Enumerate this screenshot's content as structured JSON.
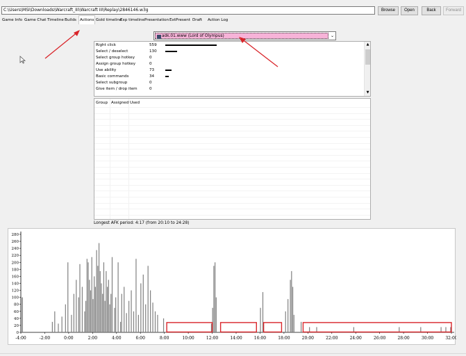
{
  "path_value": "C:\\Users\\MSI\\Downloads\\Warcraft_III\\Warcraft III\\Replay\\2846146.w3g",
  "buttons": {
    "browse": "Browse",
    "open": "Open",
    "back": "Back",
    "forward": "Forward"
  },
  "tabs": [
    "Game Info",
    "Game Chat",
    "Timeline",
    "Builds",
    "Actions",
    "Gold timeline",
    "Exp timeline",
    "Presentation",
    "ExtPresent",
    "Draft",
    "Action Log"
  ],
  "active_tab": "Actions",
  "player_select": {
    "value": "adk.01.www (Lord of Olympus)"
  },
  "actions": [
    {
      "label": "Right click",
      "value": "559",
      "count": 559
    },
    {
      "label": "Select / deselect",
      "value": "130",
      "count": 130
    },
    {
      "label": "Select group hotkey",
      "value": "0",
      "count": 0
    },
    {
      "label": "Assign group hotkey",
      "value": "0",
      "count": 0
    },
    {
      "label": "Use ability",
      "value": "73",
      "count": 73
    },
    {
      "label": "Basic commands",
      "value": "34",
      "count": 34
    },
    {
      "label": "Select subgroup",
      "value": "0",
      "count": 0
    },
    {
      "label": "Give item / drop item",
      "value": "0",
      "count": 0
    }
  ],
  "groups_table": {
    "columns": [
      "Group",
      "Assigned",
      "Used"
    ]
  },
  "afk_text": "Longest AFK period: 4:17 (from 20:10 to 24:28)",
  "colors": {
    "player_highlight": "#f7b3d8",
    "bar": "#808080",
    "annotation": "#d9252a"
  },
  "chart_data": {
    "type": "bar",
    "x_ticks": [
      "-4:00",
      "-2:00",
      "0:00",
      "2:00",
      "4:00",
      "6:00",
      "8:00",
      "10:00",
      "12:00",
      "14:00",
      "16:00",
      "18:00",
      "20:00",
      "22:00",
      "24:00",
      "26:00",
      "28:00",
      "30:00",
      "32:00"
    ],
    "y_ticks": [
      0,
      20,
      40,
      60,
      80,
      100,
      120,
      140,
      160,
      180,
      200,
      220,
      240,
      260,
      280
    ],
    "xlim_minutes": [
      -4,
      32
    ],
    "ylim": [
      0,
      280
    ],
    "grid": false,
    "bars": [
      [
        -4.0,
        100
      ],
      [
        -3.9,
        100
      ],
      [
        -1.4,
        30
      ],
      [
        -1.2,
        60
      ],
      [
        -0.9,
        25
      ],
      [
        -0.6,
        45
      ],
      [
        -0.3,
        80
      ],
      [
        -0.1,
        200
      ],
      [
        0.2,
        50
      ],
      [
        0.4,
        110
      ],
      [
        0.6,
        150
      ],
      [
        0.8,
        100
      ],
      [
        0.9,
        195
      ],
      [
        1.1,
        130
      ],
      [
        1.3,
        60
      ],
      [
        1.4,
        90
      ],
      [
        1.5,
        210
      ],
      [
        1.6,
        200
      ],
      [
        1.7,
        150
      ],
      [
        1.8,
        120
      ],
      [
        1.9,
        215
      ],
      [
        2.0,
        95
      ],
      [
        2.1,
        160
      ],
      [
        2.2,
        130
      ],
      [
        2.3,
        235
      ],
      [
        2.4,
        190
      ],
      [
        2.5,
        255
      ],
      [
        2.6,
        175
      ],
      [
        2.7,
        140
      ],
      [
        2.8,
        110
      ],
      [
        2.9,
        200
      ],
      [
        3.0,
        90
      ],
      [
        3.1,
        175
      ],
      [
        3.2,
        130
      ],
      [
        3.3,
        150
      ],
      [
        3.4,
        80
      ],
      [
        3.5,
        110
      ],
      [
        3.6,
        215
      ],
      [
        3.8,
        70
      ],
      [
        3.9,
        100
      ],
      [
        4.1,
        200
      ],
      [
        4.3,
        30
      ],
      [
        4.4,
        110
      ],
      [
        4.6,
        130
      ],
      [
        4.8,
        55
      ],
      [
        5.0,
        90
      ],
      [
        5.2,
        120
      ],
      [
        5.4,
        60
      ],
      [
        5.6,
        210
      ],
      [
        5.8,
        50
      ],
      [
        6.0,
        140
      ],
      [
        6.2,
        165
      ],
      [
        6.4,
        80
      ],
      [
        6.6,
        190
      ],
      [
        6.8,
        120
      ],
      [
        7.0,
        85
      ],
      [
        7.2,
        60
      ],
      [
        7.4,
        50
      ],
      [
        7.9,
        40
      ],
      [
        11.9,
        25
      ],
      [
        12.0,
        70
      ],
      [
        12.1,
        190
      ],
      [
        12.2,
        200
      ],
      [
        12.3,
        100
      ],
      [
        16.0,
        70
      ],
      [
        16.2,
        115
      ],
      [
        18.1,
        60
      ],
      [
        18.3,
        95
      ],
      [
        18.5,
        150
      ],
      [
        18.6,
        175
      ],
      [
        18.7,
        130
      ],
      [
        18.8,
        50
      ],
      [
        19.4,
        30
      ],
      [
        20.1,
        15
      ],
      [
        20.7,
        15
      ],
      [
        23.8,
        15
      ],
      [
        27.6,
        15
      ],
      [
        29.4,
        15
      ],
      [
        31.1,
        15
      ],
      [
        31.5,
        15
      ],
      [
        31.9,
        15
      ]
    ],
    "highlight_ranges_minutes": [
      [
        8.2,
        12.0
      ],
      [
        12.7,
        15.7
      ],
      [
        16.3,
        17.8
      ],
      [
        19.6,
        32.0
      ]
    ],
    "highlight_ymax": 28
  }
}
